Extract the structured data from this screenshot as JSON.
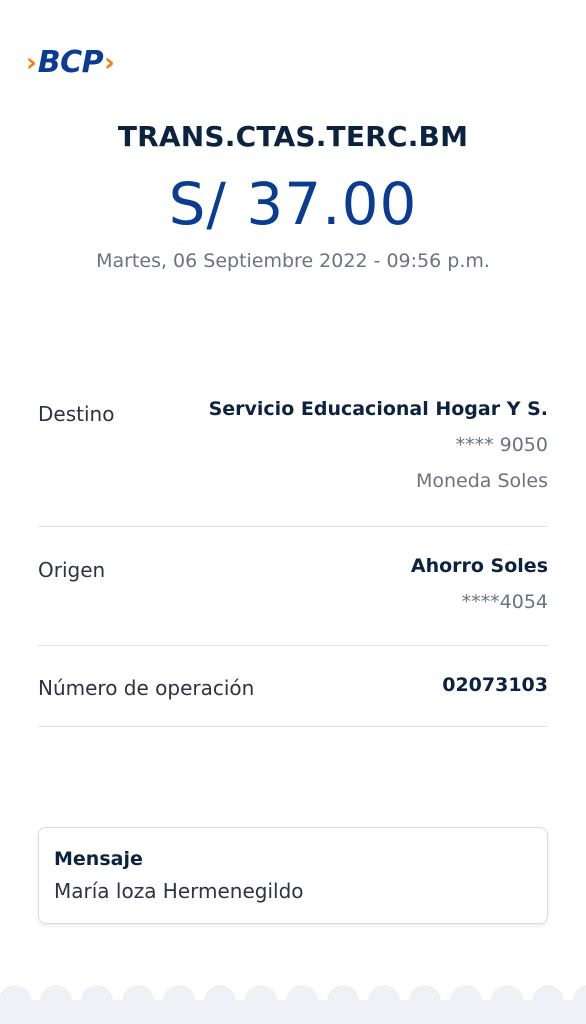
{
  "brand": {
    "logo_text": "BCP",
    "left_chevron": "›",
    "right_chevron": "›"
  },
  "header": {
    "operation_title": "TRANS.CTAS.TERC.BM",
    "amount": "S/ 37.00",
    "datetime": "Martes, 06 Septiembre 2022 - 09:56 p.m."
  },
  "details": {
    "destino": {
      "label": "Destino",
      "name": "Servicio Educacional Hogar Y S.",
      "account": "**** 9050",
      "currency": "Moneda Soles"
    },
    "origen": {
      "label": "Origen",
      "account_type": "Ahorro Soles",
      "account": "****4054"
    },
    "operacion": {
      "label": "Número de operación",
      "number": "02073103"
    }
  },
  "message": {
    "title": "Mensaje",
    "text": "María loza Hermenegildo"
  },
  "colors": {
    "brand_blue": "#0a3d91",
    "brand_orange": "#ff7800",
    "text_dark": "#0c2340",
    "text_muted": "#6a7480",
    "divider": "#dfe3e8",
    "scallop_bg": "#eef1f6"
  }
}
